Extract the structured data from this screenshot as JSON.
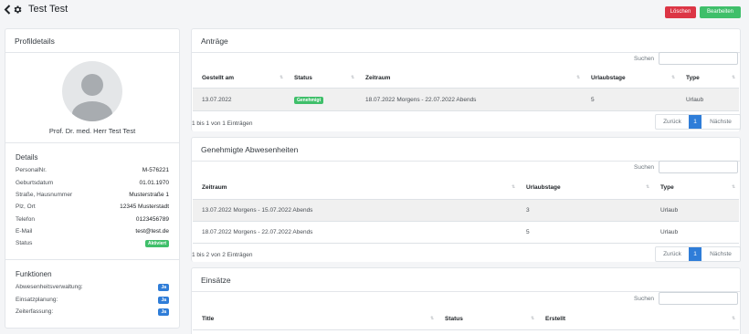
{
  "header": {
    "title": "Test Test",
    "back_icon": "chevron-left-icon",
    "settings_icon": "gear-icon",
    "delete_label": "Löschen",
    "edit_label": "Bearbeiten"
  },
  "colors": {
    "danger": "#dc3545",
    "success": "#3fbf6a",
    "primary": "#2f7dd8",
    "background": "#f4f5f7"
  },
  "profile": {
    "section_title": "Profildetails",
    "name": "Prof. Dr. med. Herr Test Test",
    "details_title": "Details",
    "details": [
      {
        "label": "PersonalNr.",
        "value": "M-576221"
      },
      {
        "label": "Geburtsdatum",
        "value": "01.01.1970"
      },
      {
        "label": "Straße, Hausnummer",
        "value": "Musterstraße 1"
      },
      {
        "label": "Plz, Ort",
        "value": "12345 Musterstadt"
      },
      {
        "label": "Telefon",
        "value": "0123456789"
      },
      {
        "label": "E-Mail",
        "value": "test@test.de"
      },
      {
        "label": "Status",
        "value": "Aktiviert"
      }
    ],
    "functions_title": "Funktionen",
    "functions": [
      {
        "label": "Abwesenheitsverwaltung:",
        "value": "Ja"
      },
      {
        "label": "Einsatzplanung:",
        "value": "Ja"
      },
      {
        "label": "Zeiterfassung:",
        "value": "Ja"
      }
    ]
  },
  "antraege": {
    "title": "Anträge",
    "search_label": "Suchen",
    "columns": [
      "Gestellt am",
      "Status",
      "Zeitraum",
      "Urlaubstage",
      "Type"
    ],
    "rows": [
      {
        "date": "13.07.2022",
        "status": "Genehmigt",
        "period": "18.07.2022 Morgens - 22.07.2022 Abends",
        "days": "5",
        "type": "Urlaub"
      }
    ],
    "info": "1 bis 1 von 1 Einträgen",
    "prev": "Zurück",
    "page": "1",
    "next": "Nächste"
  },
  "absences": {
    "title": "Genehmigte Abwesenheiten",
    "search_label": "Suchen",
    "columns": [
      "Zeitraum",
      "Urlaubstage",
      "Type"
    ],
    "rows": [
      {
        "period": "13.07.2022 Morgens - 15.07.2022 Abends",
        "days": "3",
        "type": "Urlaub"
      },
      {
        "period": "18.07.2022 Morgens - 22.07.2022 Abends",
        "days": "5",
        "type": "Urlaub"
      }
    ],
    "info": "1 bis 2 von 2 Einträgen",
    "prev": "Zurück",
    "page": "1",
    "next": "Nächste"
  },
  "einsaetze": {
    "title": "Einsätze",
    "search_label": "Suchen",
    "columns": [
      "Title",
      "Status",
      "Erstellt"
    ]
  }
}
